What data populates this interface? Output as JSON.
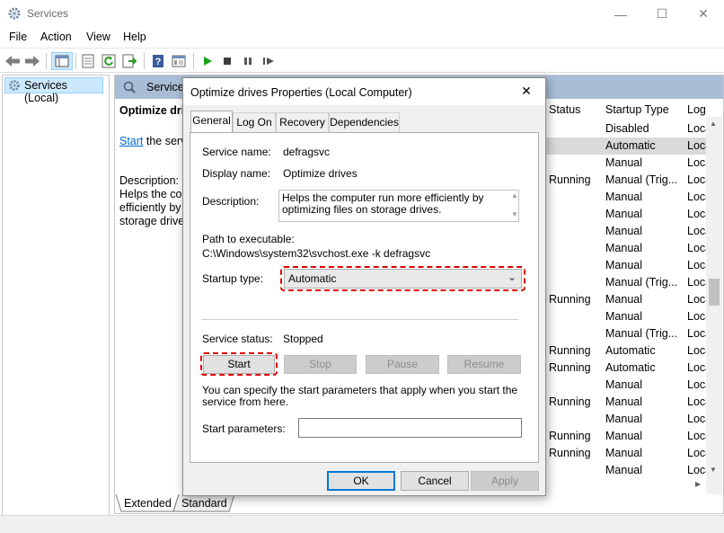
{
  "window": {
    "title": "Services",
    "minimize": "—",
    "maximize": "☐",
    "close": "✕"
  },
  "menu": [
    "File",
    "Action",
    "View",
    "Help"
  ],
  "toolbar_icons": [
    "back-icon",
    "forward-icon",
    "console-tree-icon",
    "properties-icon",
    "refresh-icon",
    "export-icon",
    "help-icon",
    "view-icon",
    "play-icon",
    "stop-icon",
    "pause-icon",
    "restart-icon"
  ],
  "tree": {
    "item": "Services (Local)"
  },
  "pane": {
    "header": "Services",
    "heading": "Optimize dri",
    "start_link": "Start",
    "start_suffix": " the servi",
    "description_label": "Description:",
    "description_lines": [
      "Helps the cor",
      "efficiently by",
      "storage drives"
    ]
  },
  "columns": {
    "status": "Status",
    "startup_type": "Startup Type",
    "log_on": "Log"
  },
  "rows": [
    {
      "status": "",
      "startup": "Disabled",
      "log": "Loca",
      "selected": false
    },
    {
      "status": "",
      "startup": "Automatic",
      "log": "Loca",
      "selected": true
    },
    {
      "status": "",
      "startup": "Manual",
      "log": "Loca",
      "selected": false
    },
    {
      "status": "Running",
      "startup": "Manual (Trig...",
      "log": "Loca",
      "selected": false
    },
    {
      "status": "",
      "startup": "Manual",
      "log": "Loca",
      "selected": false
    },
    {
      "status": "",
      "startup": "Manual",
      "log": "Loca",
      "selected": false
    },
    {
      "status": "",
      "startup": "Manual",
      "log": "Loca",
      "selected": false
    },
    {
      "status": "",
      "startup": "Manual",
      "log": "Loca",
      "selected": false
    },
    {
      "status": "",
      "startup": "Manual",
      "log": "Loca",
      "selected": false
    },
    {
      "status": "",
      "startup": "Manual (Trig...",
      "log": "Loca",
      "selected": false
    },
    {
      "status": "Running",
      "startup": "Manual",
      "log": "Loca",
      "selected": false
    },
    {
      "status": "",
      "startup": "Manual",
      "log": "Loca",
      "selected": false
    },
    {
      "status": "",
      "startup": "Manual (Trig...",
      "log": "Loca",
      "selected": false
    },
    {
      "status": "Running",
      "startup": "Automatic",
      "log": "Loca",
      "selected": false
    },
    {
      "status": "Running",
      "startup": "Automatic",
      "log": "Loca",
      "selected": false
    },
    {
      "status": "",
      "startup": "Manual",
      "log": "Loca",
      "selected": false
    },
    {
      "status": "Running",
      "startup": "Manual",
      "log": "Loca",
      "selected": false
    },
    {
      "status": "",
      "startup": "Manual",
      "log": "Loca",
      "selected": false
    },
    {
      "status": "Running",
      "startup": "Manual",
      "log": "Loca",
      "selected": false
    },
    {
      "status": "Running",
      "startup": "Manual",
      "log": "Loca",
      "selected": false
    },
    {
      "status": "",
      "startup": "Manual",
      "log": "Loca",
      "selected": false
    }
  ],
  "bottom_tabs": {
    "extended": "Extended",
    "standard": "Standard"
  },
  "dialog": {
    "title": "Optimize drives Properties (Local Computer)",
    "close": "✕",
    "tabs": [
      "General",
      "Log On",
      "Recovery",
      "Dependencies"
    ],
    "service_name_label": "Service name:",
    "service_name": "defragsvc",
    "display_name_label": "Display name:",
    "display_name": "Optimize drives",
    "description_label": "Description:",
    "description": "Helps the computer run more efficiently by optimizing files on storage drives.",
    "path_label": "Path to executable:",
    "path": "C:\\Windows\\system32\\svchost.exe -k defragsvc",
    "startup_type_label": "Startup type:",
    "startup_type": "Automatic",
    "service_status_label": "Service status:",
    "service_status": "Stopped",
    "buttons": {
      "start": "Start",
      "stop": "Stop",
      "pause": "Pause",
      "resume": "Resume"
    },
    "hint": "You can specify the start parameters that apply when you start the service from here.",
    "start_params_label": "Start parameters:",
    "start_params": "",
    "footer": {
      "ok": "OK",
      "cancel": "Cancel",
      "apply": "Apply"
    }
  },
  "colors": {
    "highlight": "#e00000",
    "selection": "#cce8ff",
    "header": "#a9bdd6",
    "link": "#0066cc"
  }
}
